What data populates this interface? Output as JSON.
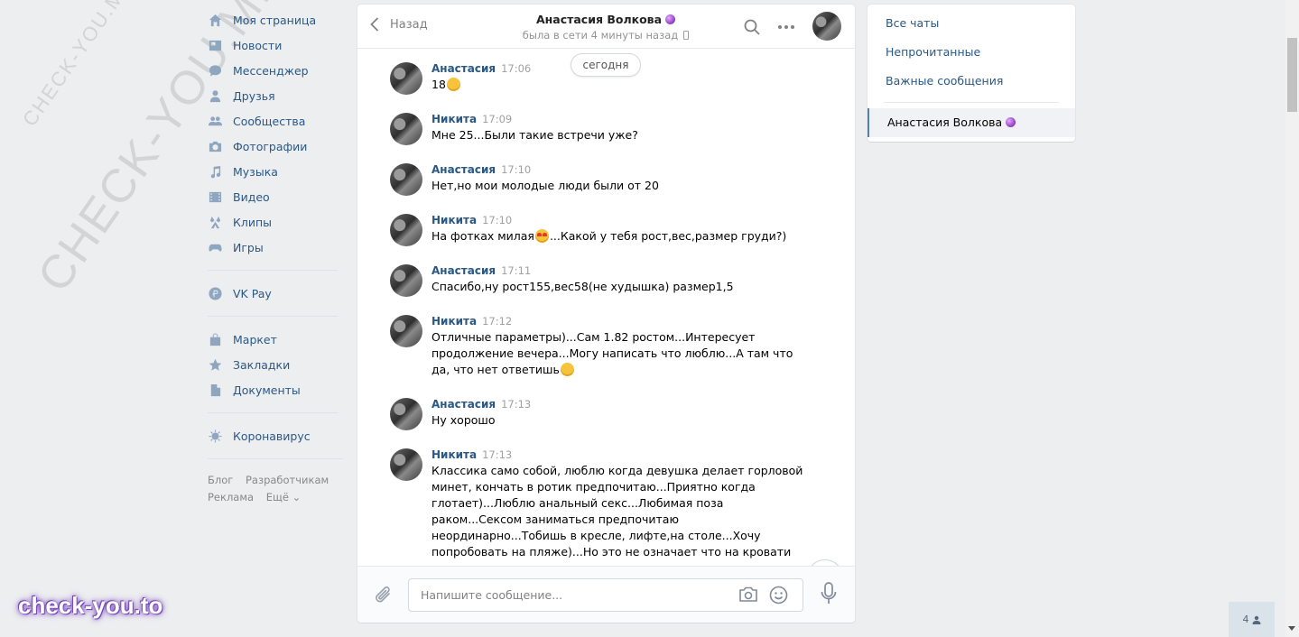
{
  "watermarks": {
    "small": "CHECK-YOU.ME",
    "big": "CHECK-YOU.ME",
    "bottom": "check-you.to"
  },
  "sidebar": {
    "items": [
      {
        "label": "Моя страница",
        "icon": "home-icon"
      },
      {
        "label": "Новости",
        "icon": "news-icon"
      },
      {
        "label": "Мессенджер",
        "icon": "messenger-icon"
      },
      {
        "label": "Друзья",
        "icon": "friends-icon"
      },
      {
        "label": "Сообщества",
        "icon": "communities-icon"
      },
      {
        "label": "Фотографии",
        "icon": "camera-icon"
      },
      {
        "label": "Музыка",
        "icon": "music-icon"
      },
      {
        "label": "Видео",
        "icon": "video-icon"
      },
      {
        "label": "Клипы",
        "icon": "clips-icon"
      },
      {
        "label": "Игры",
        "icon": "gamepad-icon"
      },
      {
        "label": "VK Pay",
        "icon": "ruble-icon"
      },
      {
        "label": "Маркет",
        "icon": "bag-icon"
      },
      {
        "label": "Закладки",
        "icon": "star-icon"
      },
      {
        "label": "Документы",
        "icon": "document-icon"
      },
      {
        "label": "Коронавирус",
        "icon": "virus-icon"
      }
    ],
    "footer": {
      "blog": "Блог",
      "developers": "Разработчикам",
      "ads": "Реклама",
      "more": "Ещё ⌄"
    }
  },
  "chat": {
    "back_label": "Назад",
    "contact_name": "Анастасия Волкова",
    "contact_status": "была в сети 4 минуты назад",
    "date_divider": "сегодня",
    "messages": [
      {
        "author": "Анастасия",
        "time": "17:06",
        "text": "18",
        "emoji": "grin"
      },
      {
        "author": "Никита",
        "time": "17:09",
        "text": "Мне 25...Были такие встречи уже?"
      },
      {
        "author": "Анастасия",
        "time": "17:10",
        "text": "Нет,но мои молодые люди были от 20"
      },
      {
        "author": "Никита",
        "time": "17:10",
        "text_before": "На фотках милая",
        "text_after": "...Какой у тебя рост,вес,размер груди?)",
        "emoji": "heart-eyes"
      },
      {
        "author": "Анастасия",
        "time": "17:11",
        "text": "Спасибо,ну рост155,вес58(не худышка) размер1,5"
      },
      {
        "author": "Никита",
        "time": "17:12",
        "lines": [
          "Отличные параметры)...Сам 1.82 ростом...Интересует",
          "продолжение вечера...Могу написать что люблю...А там что",
          "да, что нет ответишь"
        ],
        "emoji": "flushed"
      },
      {
        "author": "Анастасия",
        "time": "17:13",
        "text": "Ну хорошо"
      },
      {
        "author": "Никита",
        "time": "17:13",
        "lines": [
          "Классика само собой, люблю когда девушка делает горловой",
          "минет, кончать в ротик предпочитаю...Приятно когда",
          "глотает)...Люблю анальный секс...Любимая поза",
          "раком...Сексом заниматься предпочитаю",
          "неординарно...Тобишь в кресле, лифте,на столе...Хочу",
          "попробовать на пляже)...Но это не означает что на кровати им"
        ]
      }
    ],
    "composer_placeholder": "Напишите сообщение..."
  },
  "right_panel": {
    "all_chats": "Все чаты",
    "unread": "Непрочитанные",
    "important": "Важные сообщения",
    "active_chat": "Анастасия Волкова"
  },
  "online_count": "4",
  "colors": {
    "link": "#2a5885",
    "background": "#edeef0",
    "accent": "#5181b8"
  }
}
